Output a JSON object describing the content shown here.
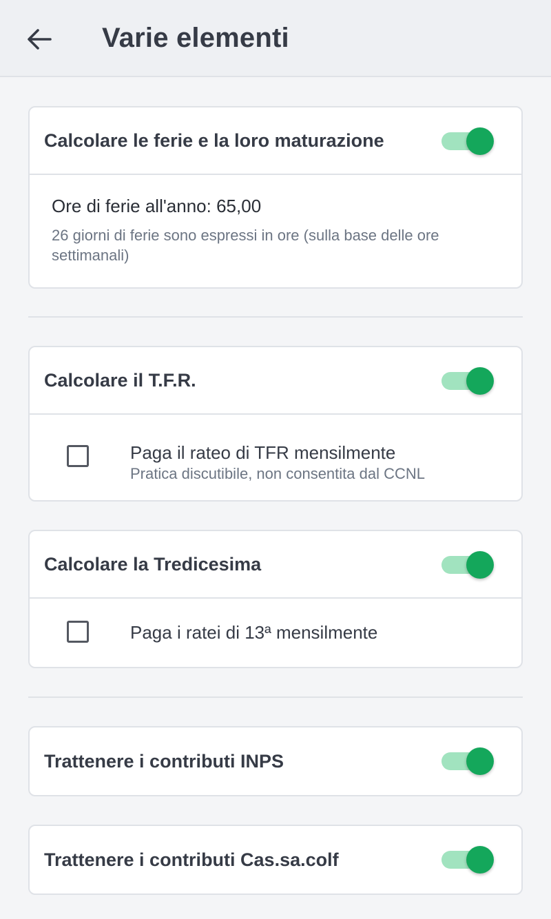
{
  "header": {
    "title": "Varie elementi",
    "back_icon": "arrow-left-icon"
  },
  "colors": {
    "toggle_on_thumb": "#14a75b",
    "toggle_on_track": "#a1e3bf"
  },
  "cards": {
    "ferie": {
      "title": "Calcolare le ferie e la loro maturazione",
      "toggle_on": true,
      "hours_label": "Ore di ferie all'anno: 65,00",
      "hours_note": "26 giorni di ferie sono espressi in ore (sulla base delle ore settimanali)"
    },
    "tfr": {
      "title": "Calcolare il T.F.R.",
      "toggle_on": true,
      "option_label": "Paga il rateo di TFR mensilmente",
      "option_note": "Pratica discutibile, non consentita dal CCNL",
      "option_checked": false
    },
    "tredicesima": {
      "title": "Calcolare la Tredicesima",
      "toggle_on": true,
      "option_label": "Paga i ratei di 13ª mensilmente",
      "option_checked": false
    },
    "inps": {
      "title": "Trattenere i contributi INPS",
      "toggle_on": true
    },
    "cassacolf": {
      "title": "Trattenere i contributi Cas.sa.colf",
      "toggle_on": true
    }
  }
}
